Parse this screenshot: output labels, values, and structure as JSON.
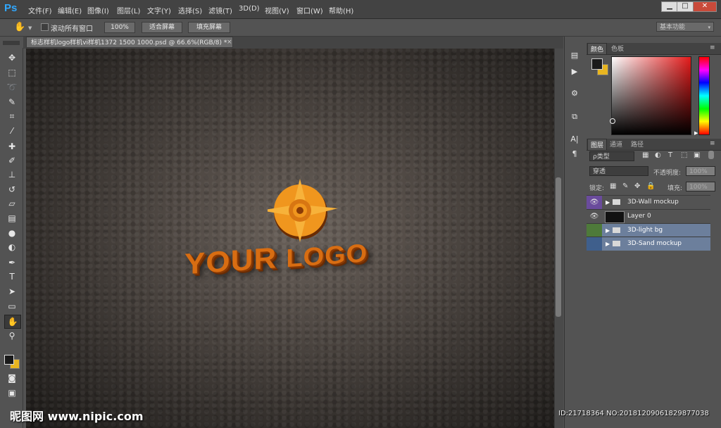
{
  "app": {
    "logo": "Ps",
    "accent": "#31a8ff"
  },
  "menu": [
    "文件(F)",
    "编辑(E)",
    "图像(I)",
    "图层(L)",
    "文字(Y)",
    "选择(S)",
    "滤镜(T)",
    "3D(D)",
    "视图(V)",
    "窗口(W)",
    "帮助(H)"
  ],
  "window_controls": {
    "minimize": "▁",
    "maximize": "□",
    "close": "✕"
  },
  "options": {
    "tool_icon": "hand-icon",
    "scroll_all_label": "滚动所有窗口",
    "btn_100": "100%",
    "btn_fit": "适合屏幕",
    "btn_fill": "填充屏幕",
    "workspace": "基本功能"
  },
  "document": {
    "tab_title": "标志样机logo样机vi样机1372 1500 1000.psd @ 66.6%(RGB/8) *",
    "close": "×",
    "logo_text_1": "YOUR",
    "logo_text_2": "LOGO"
  },
  "tools": [
    "move-icon",
    "marquee-icon",
    "lasso-icon",
    "quick-select-icon",
    "crop-icon",
    "eyedropper-icon",
    "healing-icon",
    "brush-icon",
    "stamp-icon",
    "history-brush-icon",
    "eraser-icon",
    "gradient-icon",
    "blur-icon",
    "dodge-icon",
    "pen-icon",
    "type-icon",
    "path-select-icon",
    "shape-icon",
    "hand-icon",
    "zoom-icon"
  ],
  "color_panel": {
    "tabs": [
      "颜色",
      "色板"
    ],
    "foreground": "#1a1a1a",
    "background": "#e8b520"
  },
  "layers_panel": {
    "tabs": [
      "图层",
      "通道",
      "路径"
    ],
    "filter_label": "ρ类型",
    "blend_mode": "穿透",
    "opacity_label": "不透明度:",
    "opacity_value": "100%",
    "lock_label": "锁定:",
    "fill_label": "填充:",
    "fill_value": "100%",
    "layers": [
      {
        "name": "3D-Wall mockup",
        "type": "group",
        "visible": true,
        "selected": false,
        "tag": "#6a4b9c"
      },
      {
        "name": "Layer 0",
        "type": "pixel",
        "visible": true,
        "selected": false,
        "tag": ""
      },
      {
        "name": "3D-light bg",
        "type": "group",
        "visible": false,
        "selected": true,
        "tag": "#4e7a3a"
      },
      {
        "name": "3D-Sand mockup",
        "type": "group",
        "visible": false,
        "selected": true,
        "tag": "#3f5f8c"
      }
    ]
  },
  "watermark": {
    "left": "昵图网 www.nipic.com",
    "right": "ID:21718364 NO:20181209061829877038"
  }
}
